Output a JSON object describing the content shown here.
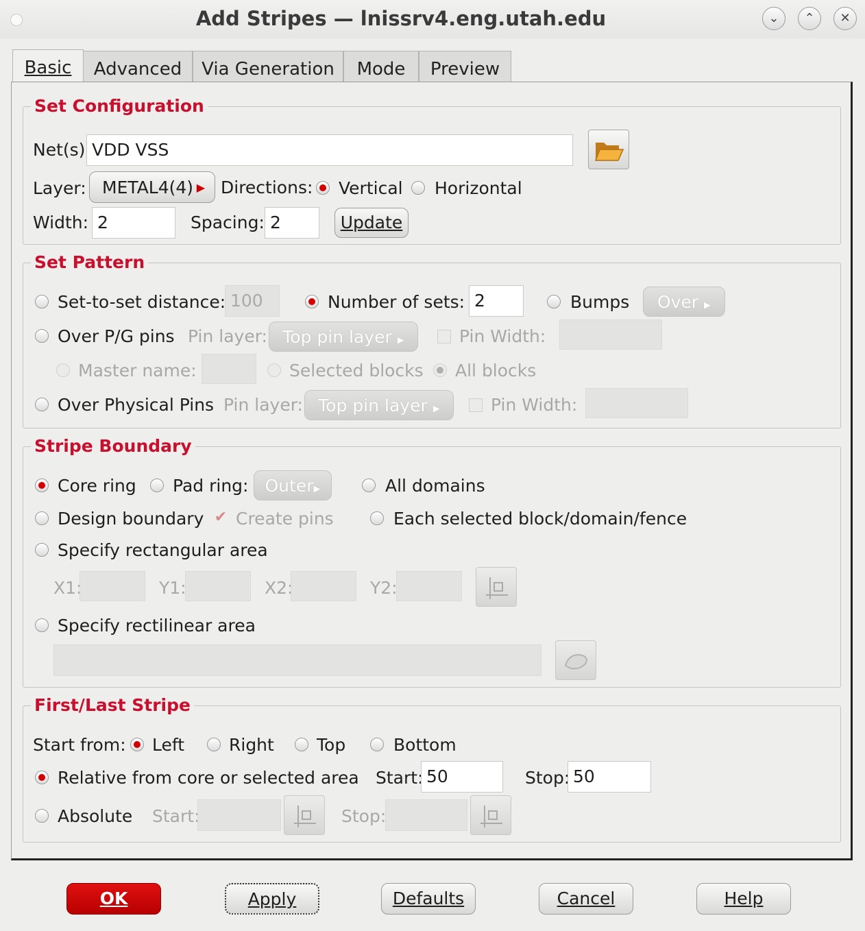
{
  "window": {
    "title": "Add Stripes — lnissrv4.eng.utah.edu",
    "buttons": [
      "minimize-icon",
      "maximize-icon",
      "close-icon"
    ]
  },
  "tabs": [
    {
      "label": "Basic",
      "active": true
    },
    {
      "label": "Advanced"
    },
    {
      "label": "Via Generation"
    },
    {
      "label": "Mode"
    },
    {
      "label": "Preview"
    }
  ],
  "set_configuration": {
    "title": "Set Configuration",
    "nets_label": "Net(s):",
    "nets_value": "VDD VSS",
    "layer_label": "Layer:",
    "layer_value": "METAL4(4)",
    "directions_label": "Directions:",
    "vertical_label": "Vertical",
    "horizontal_label": "Horizontal",
    "direction_selected": "Vertical",
    "width_label": "Width:",
    "width_value": "2",
    "spacing_label": "Spacing:",
    "spacing_value": "2",
    "update_label": "Update"
  },
  "set_pattern": {
    "title": "Set Pattern",
    "set_to_set_label": "Set-to-set distance:",
    "set_to_set_value": "100",
    "number_of_sets_label": "Number of sets:",
    "number_of_sets_value": "2",
    "bumps_label": "Bumps",
    "over_label": "Over",
    "over_pg_pins_label": "Over P/G pins",
    "pin_layer_label": "Pin layer:",
    "top_pin_layer_label": "Top pin layer",
    "pin_width_label": "Pin Width:",
    "master_name_label": "Master name:",
    "selected_blocks_label": "Selected blocks",
    "all_blocks_label": "All blocks",
    "over_physical_pins_label": "Over Physical Pins",
    "pin_layer_label2": "Pin layer:",
    "top_pin_layer_label2": "Top pin layer",
    "pin_width_label2": "Pin Width:",
    "selected": "Number of sets"
  },
  "stripe_boundary": {
    "title": "Stripe Boundary",
    "core_ring_label": "Core ring",
    "pad_ring_label": "Pad ring:",
    "outer_label": "Outer",
    "all_domains_label": "All domains",
    "design_boundary_label": "Design boundary",
    "create_pins_label": "Create pins",
    "each_selected_label": "Each selected block/domain/fence",
    "specify_rect_label": "Specify rectangular area",
    "x1_label": "X1:",
    "y1_label": "Y1:",
    "x2_label": "X2:",
    "y2_label": "Y2:",
    "specify_rectilinear_label": "Specify rectilinear area",
    "selected": "Core ring"
  },
  "first_last_stripe": {
    "title": "First/Last Stripe",
    "start_from_label": "Start from:",
    "left_label": "Left",
    "right_label": "Right",
    "top_label": "Top",
    "bottom_label": "Bottom",
    "start_from_selected": "Left",
    "relative_label": "Relative from core or selected area",
    "start_label": "Start:",
    "start_value": "50",
    "stop_label": "Stop:",
    "stop_value": "50",
    "absolute_label": "Absolute",
    "abs_start_label": "Start:",
    "abs_stop_label": "Stop:",
    "mode_selected": "Relative from core or selected area"
  },
  "footer": {
    "ok_label": "OK",
    "apply_label": "Apply",
    "defaults_label": "Defaults",
    "cancel_label": "Cancel",
    "help_label": "Help"
  },
  "colors": {
    "accent_red": "#c8102e",
    "ok_button": "#cc0000"
  }
}
